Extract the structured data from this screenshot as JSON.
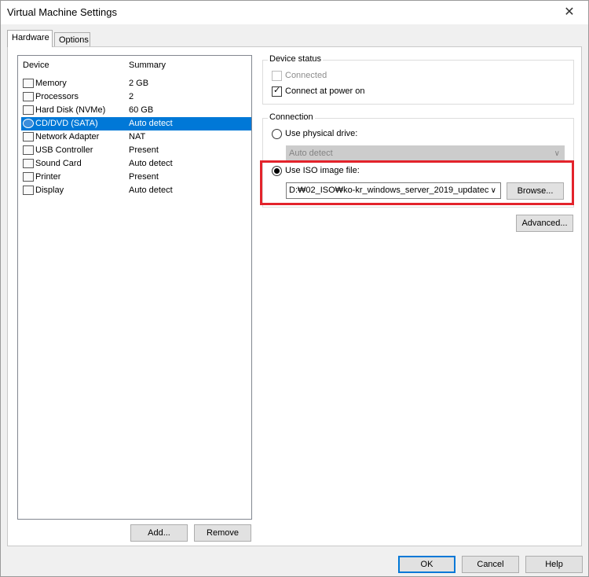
{
  "window": {
    "title": "Virtual Machine Settings"
  },
  "tabs": [
    {
      "label": "Hardware"
    },
    {
      "label": "Options"
    }
  ],
  "device_list": {
    "columns": [
      "Device",
      "Summary"
    ],
    "items": [
      {
        "name": "Memory",
        "summary": "2 GB",
        "icon": "memory-icon"
      },
      {
        "name": "Processors",
        "summary": "2",
        "icon": "processor-icon"
      },
      {
        "name": "Hard Disk (NVMe)",
        "summary": "60 GB",
        "icon": "hard-disk-icon"
      },
      {
        "name": "CD/DVD (SATA)",
        "summary": "Auto detect",
        "icon": "cd-dvd-icon",
        "selected": true
      },
      {
        "name": "Network Adapter",
        "summary": "NAT",
        "icon": "network-adapter-icon"
      },
      {
        "name": "USB Controller",
        "summary": "Present",
        "icon": "usb-icon"
      },
      {
        "name": "Sound Card",
        "summary": "Auto detect",
        "icon": "speaker-icon"
      },
      {
        "name": "Printer",
        "summary": "Present",
        "icon": "printer-icon"
      },
      {
        "name": "Display",
        "summary": "Auto detect",
        "icon": "display-icon"
      }
    ],
    "add_label": "Add...",
    "remove_label": "Remove"
  },
  "device_status": {
    "title": "Device status",
    "connected_label": "Connected",
    "connect_power_label": "Connect at power on"
  },
  "connection": {
    "title": "Connection",
    "physical_label": "Use physical drive:",
    "physical_value": "Auto detect",
    "iso_label": "Use ISO image file:",
    "iso_path": "D:₩02_ISO₩ko-kr_windows_server_2019_updatec",
    "browse_label": "Browse...",
    "advanced_label": "Advanced..."
  },
  "footer": {
    "ok_label": "OK",
    "cancel_label": "Cancel",
    "help_label": "Help"
  },
  "colors": {
    "selection": "#0078d7",
    "highlight_border": "#e3232b"
  }
}
